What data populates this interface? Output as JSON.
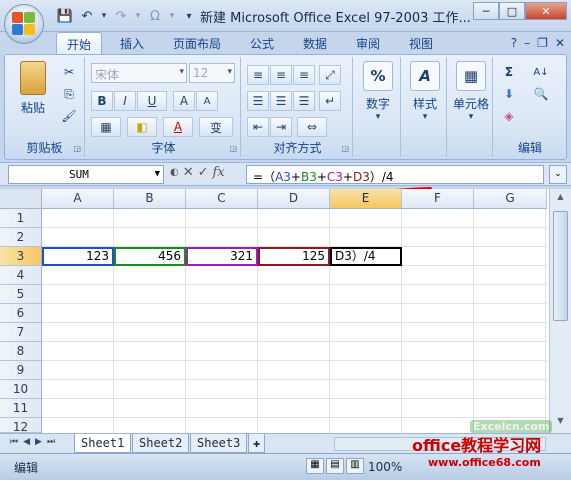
{
  "window": {
    "title": "新建 Microsoft Office Excel 97-2003 工作...",
    "minimize": "─",
    "maximize": "□",
    "close": "✕"
  },
  "qat": {
    "save": "💾",
    "undo": "↶",
    "redo": "↷",
    "customize": "▾",
    "omega": "Ω"
  },
  "tabs": [
    "开始",
    "插入",
    "页面布局",
    "公式",
    "数据",
    "审阅",
    "视图"
  ],
  "help": {
    "help": "?",
    "min": "–",
    "restore": "❐",
    "close": "✕"
  },
  "ribbon": {
    "clipboard": {
      "label": "剪贴板",
      "paste": "粘贴",
      "cut": "✂",
      "copy": "⎘",
      "painter": "🖌"
    },
    "font": {
      "label": "字体",
      "name": "宋体",
      "size": "12",
      "bold": "B",
      "italic": "I",
      "underline": "U",
      "grow": "A",
      "shrink": "A",
      "border": "▦",
      "fill": "◧",
      "color": "A",
      "phonetic": "变"
    },
    "alignment": {
      "label": "对齐方式"
    },
    "number": {
      "label": "数字",
      "icon": "%"
    },
    "styles": {
      "label": "样式",
      "icon": "A"
    },
    "cells": {
      "label": "单元格",
      "icon": "▦"
    },
    "editing": {
      "label": "编辑",
      "sum": "Σ",
      "fill": "⬇",
      "clear": "◈",
      "sort": "A↓",
      "find": "🔍"
    }
  },
  "formula_bar": {
    "namebox": "SUM",
    "formula_text": "=（A3+B3+C3+D3）/4",
    "formula_parts": [
      {
        "t": "=（",
        "c": "#000000"
      },
      {
        "t": "A3",
        "c": "#1f4ecf"
      },
      {
        "t": "+",
        "c": "#000000"
      },
      {
        "t": "B3",
        "c": "#1f8a1f"
      },
      {
        "t": "+",
        "c": "#000000"
      },
      {
        "t": "C3",
        "c": "#9b1fb0"
      },
      {
        "t": "+",
        "c": "#000000"
      },
      {
        "t": "D3",
        "c": "#8b1a1a"
      },
      {
        "t": "）/4",
        "c": "#000000"
      }
    ]
  },
  "columns": [
    "A",
    "B",
    "C",
    "D",
    "E",
    "F",
    "G"
  ],
  "rows": [
    "1",
    "2",
    "3",
    "4",
    "5",
    "6",
    "7",
    "8",
    "9",
    "10",
    "11",
    "12"
  ],
  "cells": {
    "A3": "123",
    "B3": "456",
    "C3": "321",
    "D3": "125",
    "E3": "D3）/4"
  },
  "sheet_tabs": [
    "Sheet1",
    "Sheet2",
    "Sheet3"
  ],
  "status": {
    "mode": "编辑",
    "zoom": "100%"
  },
  "watermark": {
    "line1": "office教程学习网",
    "line2": "www.office68.com",
    "stamp": "Excelcn.com"
  }
}
